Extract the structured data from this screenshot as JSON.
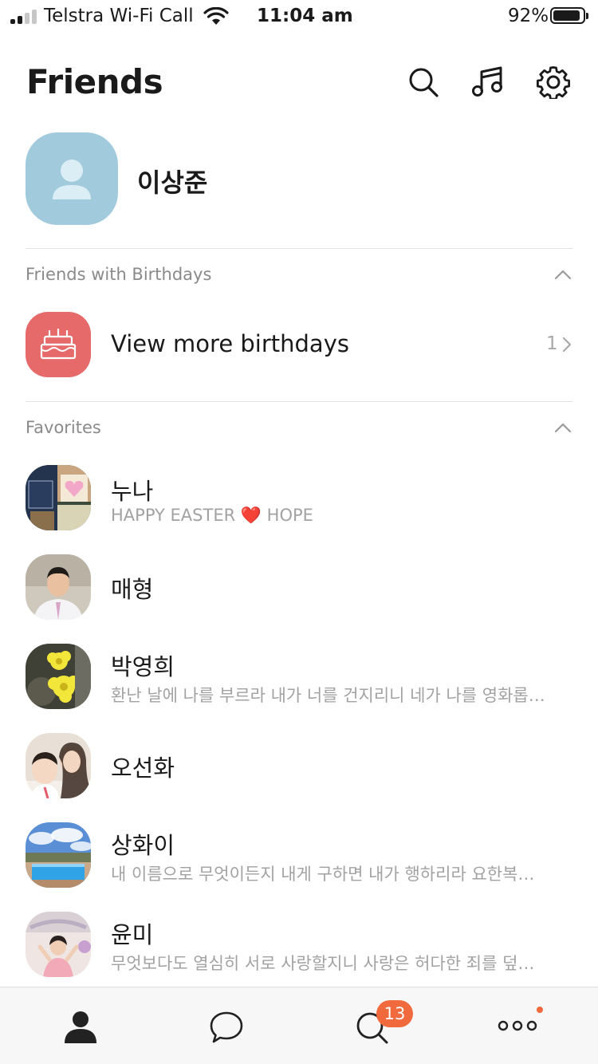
{
  "status_bar": {
    "carrier": "Telstra Wi-Fi Call",
    "time": "11:04 am",
    "battery_percent": "92%",
    "battery_level": 0.92,
    "signal_bars_active": 2,
    "signal_bars_total": 4
  },
  "header": {
    "title": "Friends",
    "icons": [
      "search-icon",
      "music-icon",
      "gear-icon"
    ]
  },
  "profile": {
    "name": "이상준"
  },
  "birthdays": {
    "section_label": "Friends with Birthdays",
    "row_label": "View more birthdays",
    "count": "1"
  },
  "favorites": {
    "section_label": "Favorites",
    "items": [
      {
        "name": "누나",
        "status": "HAPPY EASTER ❤️ HOPE"
      },
      {
        "name": "매형",
        "status": ""
      },
      {
        "name": "박영희",
        "status": "환난 날에 나를 부르라 내가 너를 건지리니 네가 나를 영화롭…"
      },
      {
        "name": "오선화",
        "status": ""
      },
      {
        "name": "상화이",
        "status": "내 이름으로 무엇이든지 내게 구하면 내가 행하리라 요한복…"
      },
      {
        "name": "윤미",
        "status": "무엇보다도 열심히 서로 사랑할지니 사랑은 허다한 죄를 덮…"
      }
    ]
  },
  "tab_bar": {
    "tabs": [
      "friends-tab",
      "chats-tab",
      "view-tab",
      "more-tab"
    ],
    "view_badge": "13"
  },
  "colors": {
    "accent": "#f06a3d",
    "birthday": "#e66a6a",
    "avatar_default": "#a1cbdd"
  }
}
